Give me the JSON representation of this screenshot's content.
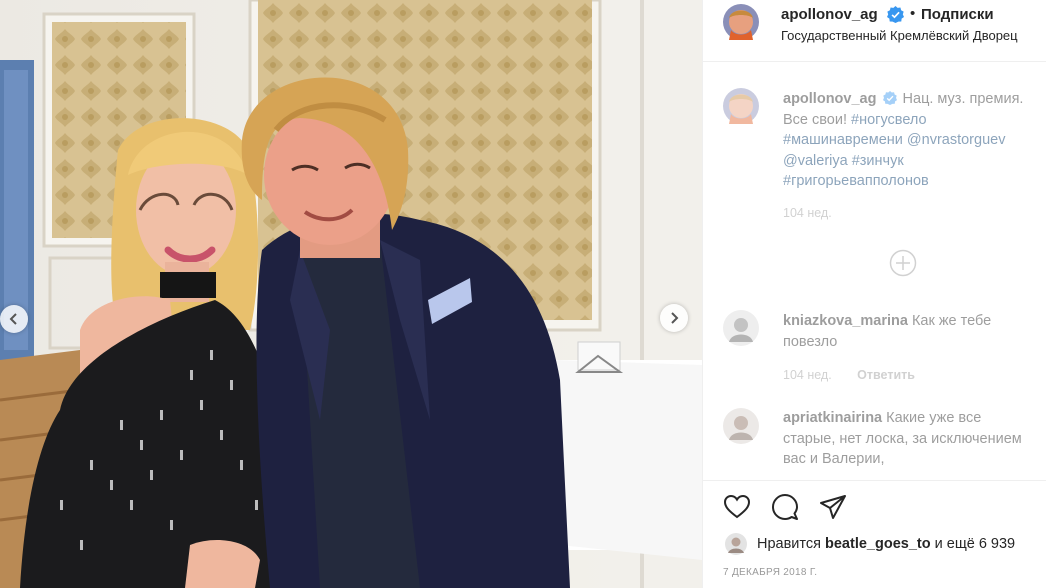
{
  "header": {
    "username": "apollonov_ag",
    "separator": "•",
    "follow_label": "Подписки",
    "location": "Государственный Кремлёвский Дворец"
  },
  "caption": {
    "username": "apollonov_ag",
    "text": "Нац. муз. премия. Все свои!",
    "tags": [
      "#ногусвело",
      "#машинавремени",
      "@nvrastorguev",
      "@valeriya",
      "#зинчук",
      "#григорьевапполонов"
    ],
    "time": "104 нед."
  },
  "comments": [
    {
      "username": "kniazkova_marina",
      "text": "Как же тебе повезло",
      "time": "104 нед.",
      "reply_label": "Ответить"
    },
    {
      "username": "apriatkinairina",
      "text": "Какие уже все старые, нет лоска, за исключением вас и Валерии,",
      "time": "",
      "reply_label": ""
    }
  ],
  "likes": {
    "prefix": "Нравится",
    "username": "beatle_goes_to",
    "suffix": "и ещё 6 939"
  },
  "date": "7 декабря 2018 г.",
  "icons": {
    "verified": "verified-badge-icon",
    "load_more": "plus-circle-icon",
    "like": "heart-icon",
    "comment": "comment-bubble-icon",
    "share": "paper-plane-icon",
    "prev": "chevron-left-icon",
    "next": "chevron-right-icon"
  },
  "colors": {
    "verified": "#3897f0",
    "hashtag": "#003569",
    "muted": "#999999"
  }
}
